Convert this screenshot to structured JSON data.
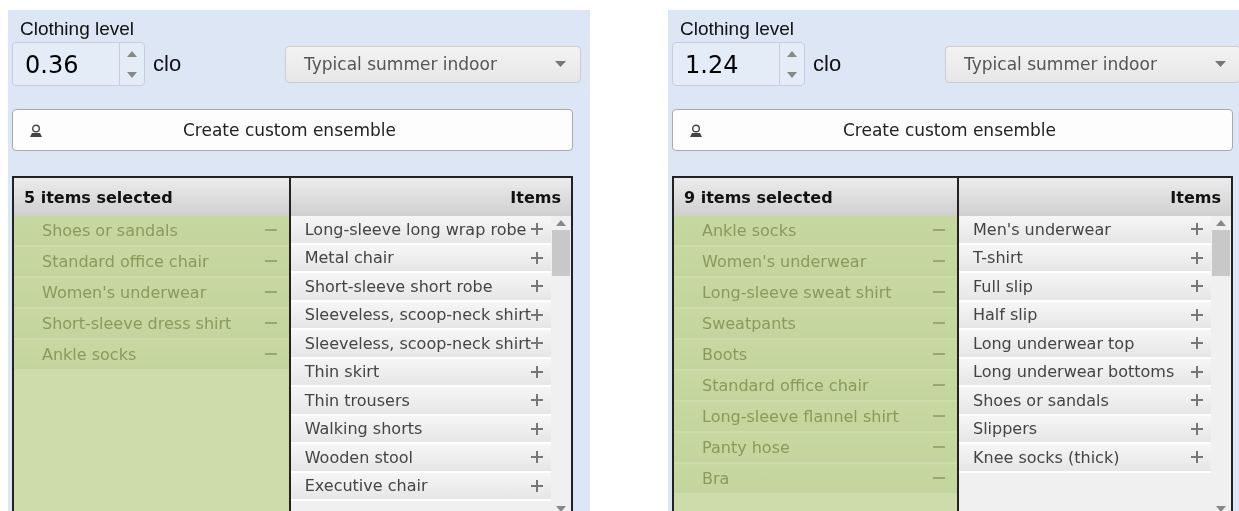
{
  "panels": [
    {
      "label": "Clothing level",
      "value": "0.36",
      "unit": "clo",
      "preset": "Typical summer indoor",
      "button": "Create custom ensemble",
      "selected_header": "5 items selected",
      "items_header": "Items",
      "selected_items": [
        "Shoes or sandals",
        "Standard office chair",
        "Women's underwear",
        "Short-sleeve dress shirt",
        "Ankle socks"
      ],
      "items": [
        "Long-sleeve long wrap robe",
        "Metal chair",
        "Short-sleeve short robe",
        "Sleeveless, scoop-neck shirt",
        "Sleeveless, scoop-neck shirt",
        "Thin skirt",
        "Thin trousers",
        "Walking shorts",
        "Wooden stool",
        "Executive chair"
      ]
    },
    {
      "label": "Clothing level",
      "value": "1.24",
      "unit": "clo",
      "preset": "Typical summer indoor",
      "button": "Create custom ensemble",
      "selected_header": "9 items selected",
      "items_header": "Items",
      "selected_items": [
        "Ankle socks",
        "Women's underwear",
        "Long-sleeve sweat shirt",
        "Sweatpants",
        "Boots",
        "Standard office chair",
        "Long-sleeve flannel shirt",
        "Panty hose",
        "Bra"
      ],
      "items": [
        "Men's underwear",
        "T-shirt",
        "Full slip",
        "Half slip",
        "Long underwear top",
        "Long underwear bottoms",
        "Shoes or sandals",
        "Slippers",
        "Knee socks (thick)"
      ]
    }
  ]
}
